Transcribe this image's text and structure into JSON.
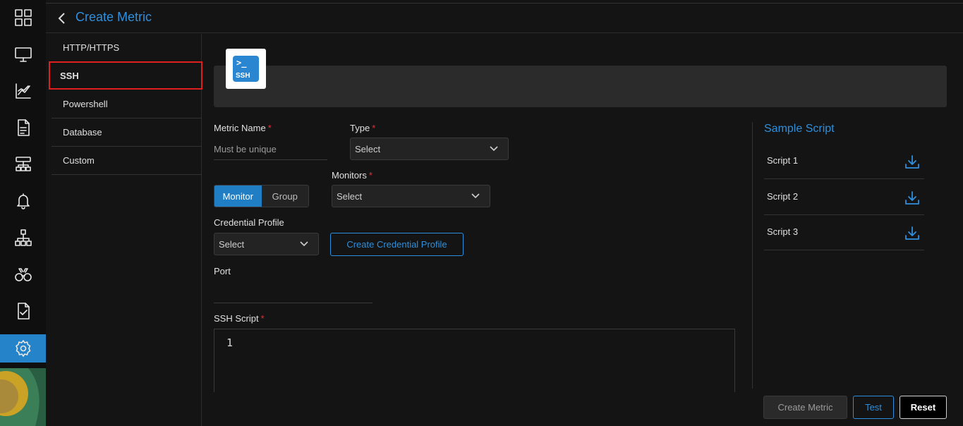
{
  "header": {
    "title": "Create Metric"
  },
  "rail": {
    "items": [
      "dashboard-icon",
      "monitor-icon",
      "chart-icon",
      "report-icon",
      "topology-icon",
      "alert-bell-icon",
      "network-icon",
      "binoculars-icon",
      "checklist-icon",
      "settings-gear-icon"
    ],
    "active": "settings-gear-icon",
    "accent": "#2583c9"
  },
  "side_menu": {
    "items": [
      {
        "label": "HTTP/HTTPS"
      },
      {
        "label": "SSH",
        "selected": true
      },
      {
        "label": "Powershell"
      },
      {
        "label": "Database"
      },
      {
        "label": "Custom"
      }
    ]
  },
  "banner": {
    "logo_prompt": ">_",
    "logo_text": "SSH"
  },
  "form": {
    "metric_name": {
      "label": "Metric Name",
      "required": "*",
      "placeholder": "Must be unique",
      "value": ""
    },
    "type": {
      "label": "Type",
      "required": "*",
      "value": "Select"
    },
    "monitor_toggle": {
      "options": [
        "Monitor",
        "Group"
      ],
      "selected": "Monitor"
    },
    "monitors": {
      "label": "Monitors",
      "required": "*",
      "value": "Select"
    },
    "credential_profile": {
      "label": "Credential Profile",
      "value": "Select",
      "create_button": "Create Credential Profile"
    },
    "port": {
      "label": "Port",
      "value": ""
    },
    "ssh_script": {
      "label": "SSH Script",
      "required": "*",
      "line_number": "1"
    }
  },
  "sample_script": {
    "title": "Sample Script",
    "items": [
      {
        "name": "Script 1"
      },
      {
        "name": "Script 2"
      },
      {
        "name": "Script 3"
      }
    ]
  },
  "footer": {
    "create_label": "Create Metric",
    "test_label": "Test",
    "reset_label": "Reset"
  },
  "colors": {
    "accent": "#2f8fdc",
    "required": "#e0313a",
    "selected_border": "#e01e1e"
  }
}
